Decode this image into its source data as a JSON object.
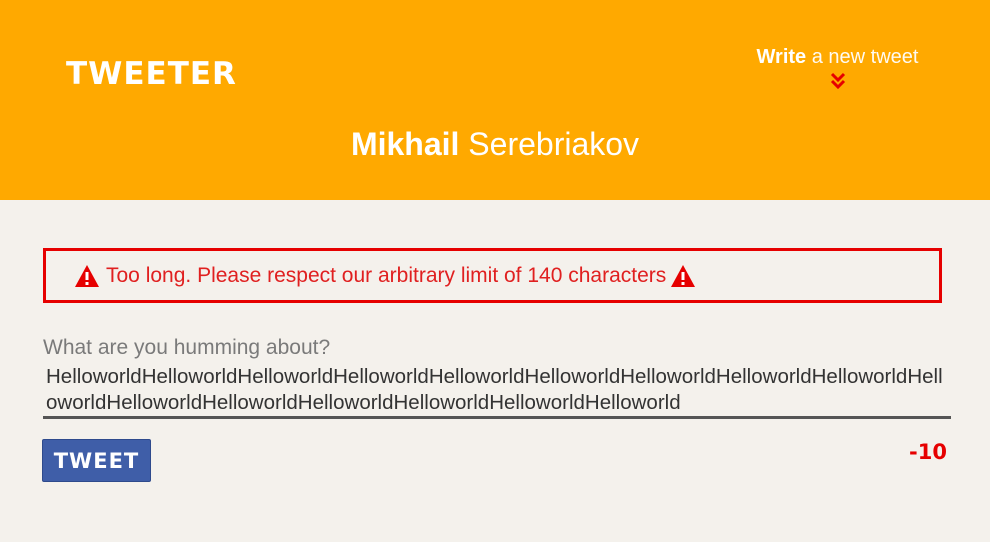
{
  "header": {
    "logo": "TWEETER",
    "compose_toggle": {
      "bold": "Write",
      "light": " a new tweet",
      "icon": "double-chevron-down-icon"
    },
    "user": {
      "first_name": "Mikhail",
      "last_name": "Serebriakov"
    }
  },
  "compose": {
    "error_message": "Too long. Please respect our arbitrary limit of 140 characters",
    "error_icon": "warning-icon",
    "label": "What are you humming about?",
    "text": "HelloworldHelloworldHelloworldHelloworldHelloworldHelloworldHelloworldHelloworldHelloworldHelloworldHelloworldHelloworldHelloworldHelloworldHelloworldHelloworld",
    "submit_label": "TWEET",
    "counter": "-10"
  },
  "colors": {
    "header_bg": "#ffa900",
    "error": "#e60000",
    "button": "#3f5ea8",
    "page_bg": "#f4f1ec"
  }
}
